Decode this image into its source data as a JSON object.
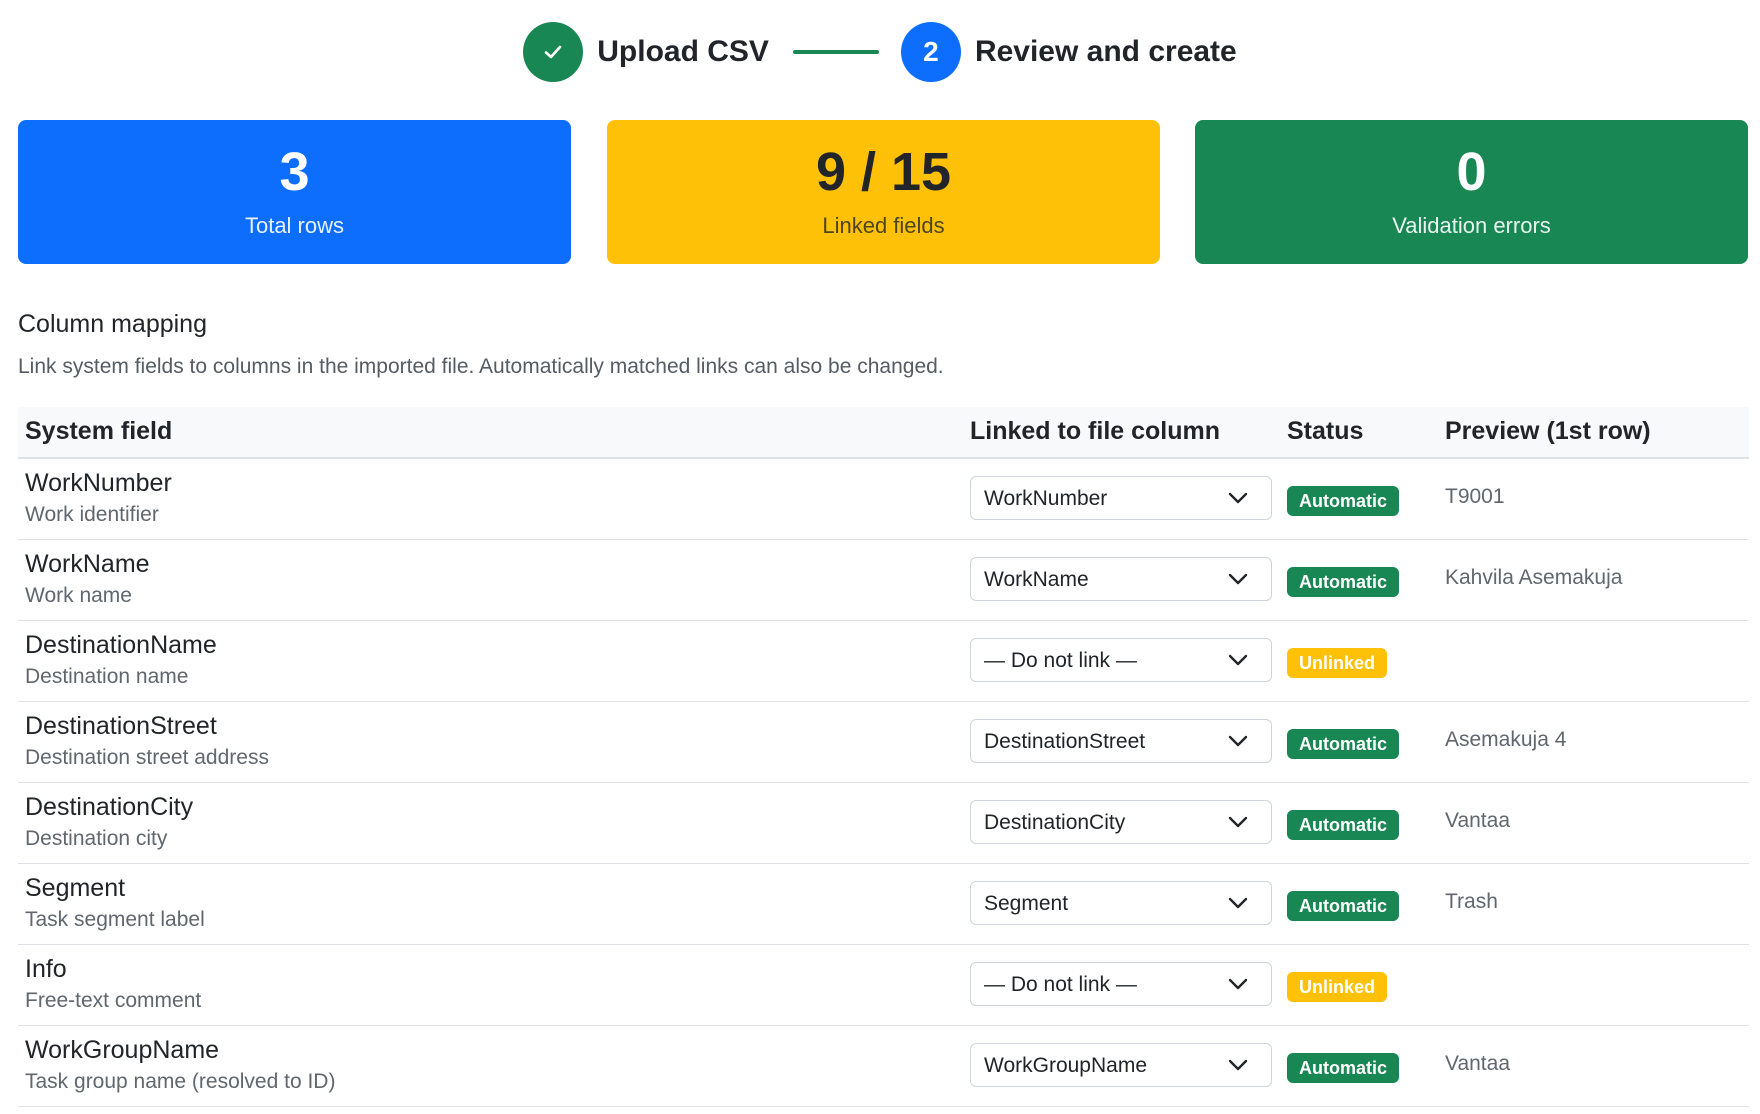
{
  "stepper": {
    "step1": {
      "label": "Upload CSV",
      "state": "done",
      "icon": "check-icon"
    },
    "step2": {
      "number": "2",
      "label": "Review and create",
      "state": "active"
    }
  },
  "stats": {
    "total_rows": {
      "value": "3",
      "label": "Total rows",
      "color": "#0d6efd"
    },
    "linked_fields": {
      "value": "9 / 15",
      "label": "Linked fields",
      "color": "#ffc107"
    },
    "validation_errors": {
      "value": "0",
      "label": "Validation errors",
      "color": "#198754"
    }
  },
  "mapping": {
    "title": "Column mapping",
    "description": "Link system fields to columns in the imported file. Automatically matched links can also be changed.",
    "columns": [
      "System field",
      "Linked to file column",
      "Status",
      "Preview (1st row)"
    ],
    "rows": [
      {
        "name": "WorkNumber",
        "desc": "Work identifier",
        "column": "WorkNumber",
        "status": "Automatic",
        "preview": "T9001"
      },
      {
        "name": "WorkName",
        "desc": "Work name",
        "column": "WorkName",
        "status": "Automatic",
        "preview": "Kahvila Asemakuja"
      },
      {
        "name": "DestinationName",
        "desc": "Destination name",
        "column": "— Do not link —",
        "status": "Unlinked",
        "preview": ""
      },
      {
        "name": "DestinationStreet",
        "desc": "Destination street address",
        "column": "DestinationStreet",
        "status": "Automatic",
        "preview": "Asemakuja 4"
      },
      {
        "name": "DestinationCity",
        "desc": "Destination city",
        "column": "DestinationCity",
        "status": "Automatic",
        "preview": "Vantaa"
      },
      {
        "name": "Segment",
        "desc": "Task segment label",
        "column": "Segment",
        "status": "Automatic",
        "preview": "Trash"
      },
      {
        "name": "Info",
        "desc": "Free-text comment",
        "column": "— Do not link —",
        "status": "Unlinked",
        "preview": ""
      },
      {
        "name": "WorkGroupName",
        "desc": "Task group name (resolved to ID)",
        "column": "WorkGroupName",
        "status": "Automatic",
        "preview": "Vantaa"
      }
    ]
  },
  "colors": {
    "primary": "#0d6efd",
    "success": "#198754",
    "warning": "#ffc107"
  }
}
